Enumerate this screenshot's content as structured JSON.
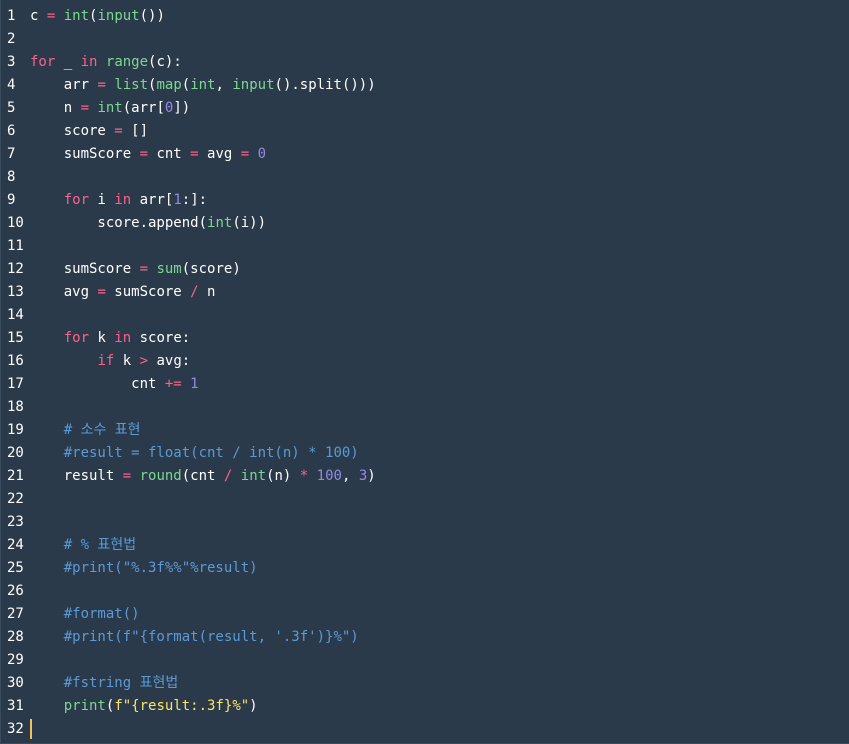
{
  "editor": {
    "language": "python",
    "colors": {
      "background": "#2b3a4a",
      "text": "#ffffff",
      "keyword": "#fc618d",
      "builtin": "#7bd88f",
      "number": "#948ae3",
      "comment": "#5a9ad6",
      "string": "#fce566",
      "cursor": "#f0c35a"
    },
    "cursor_line": 32,
    "lines": [
      {
        "n": "1",
        "tokens": [
          [
            "text",
            "c "
          ],
          [
            "op",
            "="
          ],
          [
            "text",
            " "
          ],
          [
            "builtin",
            "int"
          ],
          [
            "text",
            "("
          ],
          [
            "builtin",
            "input"
          ],
          [
            "text",
            "())"
          ]
        ]
      },
      {
        "n": "2",
        "tokens": []
      },
      {
        "n": "3",
        "tokens": [
          [
            "kw",
            "for"
          ],
          [
            "text",
            " _ "
          ],
          [
            "kw",
            "in"
          ],
          [
            "text",
            " "
          ],
          [
            "builtin",
            "range"
          ],
          [
            "text",
            "(c):"
          ]
        ]
      },
      {
        "n": "4",
        "tokens": [
          [
            "text",
            "    arr "
          ],
          [
            "op",
            "="
          ],
          [
            "text",
            " "
          ],
          [
            "builtin",
            "list"
          ],
          [
            "text",
            "("
          ],
          [
            "builtin",
            "map"
          ],
          [
            "text",
            "("
          ],
          [
            "builtin",
            "int"
          ],
          [
            "text",
            ", "
          ],
          [
            "builtin",
            "input"
          ],
          [
            "text",
            "().split()))"
          ]
        ]
      },
      {
        "n": "5",
        "tokens": [
          [
            "text",
            "    n "
          ],
          [
            "op",
            "="
          ],
          [
            "text",
            " "
          ],
          [
            "builtin",
            "int"
          ],
          [
            "text",
            "(arr["
          ],
          [
            "num",
            "0"
          ],
          [
            "text",
            "])"
          ]
        ]
      },
      {
        "n": "6",
        "tokens": [
          [
            "text",
            "    score "
          ],
          [
            "op",
            "="
          ],
          [
            "text",
            " []"
          ]
        ]
      },
      {
        "n": "7",
        "tokens": [
          [
            "text",
            "    sumScore "
          ],
          [
            "op",
            "="
          ],
          [
            "text",
            " cnt "
          ],
          [
            "op",
            "="
          ],
          [
            "text",
            " avg "
          ],
          [
            "op",
            "="
          ],
          [
            "text",
            " "
          ],
          [
            "num",
            "0"
          ]
        ]
      },
      {
        "n": "8",
        "tokens": []
      },
      {
        "n": "9",
        "tokens": [
          [
            "text",
            "    "
          ],
          [
            "kw",
            "for"
          ],
          [
            "text",
            " i "
          ],
          [
            "kw",
            "in"
          ],
          [
            "text",
            " arr["
          ],
          [
            "num",
            "1"
          ],
          [
            "text",
            ":]:"
          ]
        ]
      },
      {
        "n": "10",
        "tokens": [
          [
            "text",
            "        score.append("
          ],
          [
            "builtin",
            "int"
          ],
          [
            "text",
            "(i))"
          ]
        ]
      },
      {
        "n": "11",
        "tokens": []
      },
      {
        "n": "12",
        "tokens": [
          [
            "text",
            "    sumScore "
          ],
          [
            "op",
            "="
          ],
          [
            "text",
            " "
          ],
          [
            "builtin",
            "sum"
          ],
          [
            "text",
            "(score)"
          ]
        ]
      },
      {
        "n": "13",
        "tokens": [
          [
            "text",
            "    avg "
          ],
          [
            "op",
            "="
          ],
          [
            "text",
            " sumScore "
          ],
          [
            "op",
            "/"
          ],
          [
            "text",
            " n"
          ]
        ]
      },
      {
        "n": "14",
        "tokens": []
      },
      {
        "n": "15",
        "tokens": [
          [
            "text",
            "    "
          ],
          [
            "kw",
            "for"
          ],
          [
            "text",
            " k "
          ],
          [
            "kw",
            "in"
          ],
          [
            "text",
            " score:"
          ]
        ]
      },
      {
        "n": "16",
        "tokens": [
          [
            "text",
            "        "
          ],
          [
            "kw",
            "if"
          ],
          [
            "text",
            " k "
          ],
          [
            "op",
            ">"
          ],
          [
            "text",
            " avg:"
          ]
        ]
      },
      {
        "n": "17",
        "tokens": [
          [
            "text",
            "            cnt "
          ],
          [
            "op",
            "+="
          ],
          [
            "text",
            " "
          ],
          [
            "num",
            "1"
          ]
        ]
      },
      {
        "n": "18",
        "tokens": []
      },
      {
        "n": "19",
        "tokens": [
          [
            "text",
            "    "
          ],
          [
            "comment",
            "# 소수 표현"
          ]
        ]
      },
      {
        "n": "20",
        "tokens": [
          [
            "text",
            "    "
          ],
          [
            "comment",
            "#result = float(cnt / int(n) * 100)"
          ]
        ]
      },
      {
        "n": "21",
        "tokens": [
          [
            "text",
            "    result "
          ],
          [
            "op",
            "="
          ],
          [
            "text",
            " "
          ],
          [
            "builtin",
            "round"
          ],
          [
            "text",
            "(cnt "
          ],
          [
            "op",
            "/"
          ],
          [
            "text",
            " "
          ],
          [
            "builtin",
            "int"
          ],
          [
            "text",
            "(n) "
          ],
          [
            "op",
            "*"
          ],
          [
            "text",
            " "
          ],
          [
            "num",
            "100"
          ],
          [
            "text",
            ", "
          ],
          [
            "num",
            "3"
          ],
          [
            "text",
            ")"
          ]
        ]
      },
      {
        "n": "22",
        "tokens": []
      },
      {
        "n": "23",
        "tokens": []
      },
      {
        "n": "24",
        "tokens": [
          [
            "text",
            "    "
          ],
          [
            "comment",
            "# % 표현법"
          ]
        ]
      },
      {
        "n": "25",
        "tokens": [
          [
            "text",
            "    "
          ],
          [
            "comment",
            "#print(\"%.3f%%\"%result)"
          ]
        ]
      },
      {
        "n": "26",
        "tokens": []
      },
      {
        "n": "27",
        "tokens": [
          [
            "text",
            "    "
          ],
          [
            "comment",
            "#format()"
          ]
        ]
      },
      {
        "n": "28",
        "tokens": [
          [
            "text",
            "    "
          ],
          [
            "comment",
            "#print(f\"{format(result, '.3f')}%\")"
          ]
        ]
      },
      {
        "n": "29",
        "tokens": []
      },
      {
        "n": "30",
        "tokens": [
          [
            "text",
            "    "
          ],
          [
            "comment",
            "#fstring 표현법"
          ]
        ]
      },
      {
        "n": "31",
        "tokens": [
          [
            "text",
            "    "
          ],
          [
            "builtin",
            "print"
          ],
          [
            "text",
            "("
          ],
          [
            "str",
            "f\"{result:.3f}%\""
          ],
          [
            "text",
            ")"
          ]
        ]
      },
      {
        "n": "32",
        "tokens": []
      }
    ]
  }
}
